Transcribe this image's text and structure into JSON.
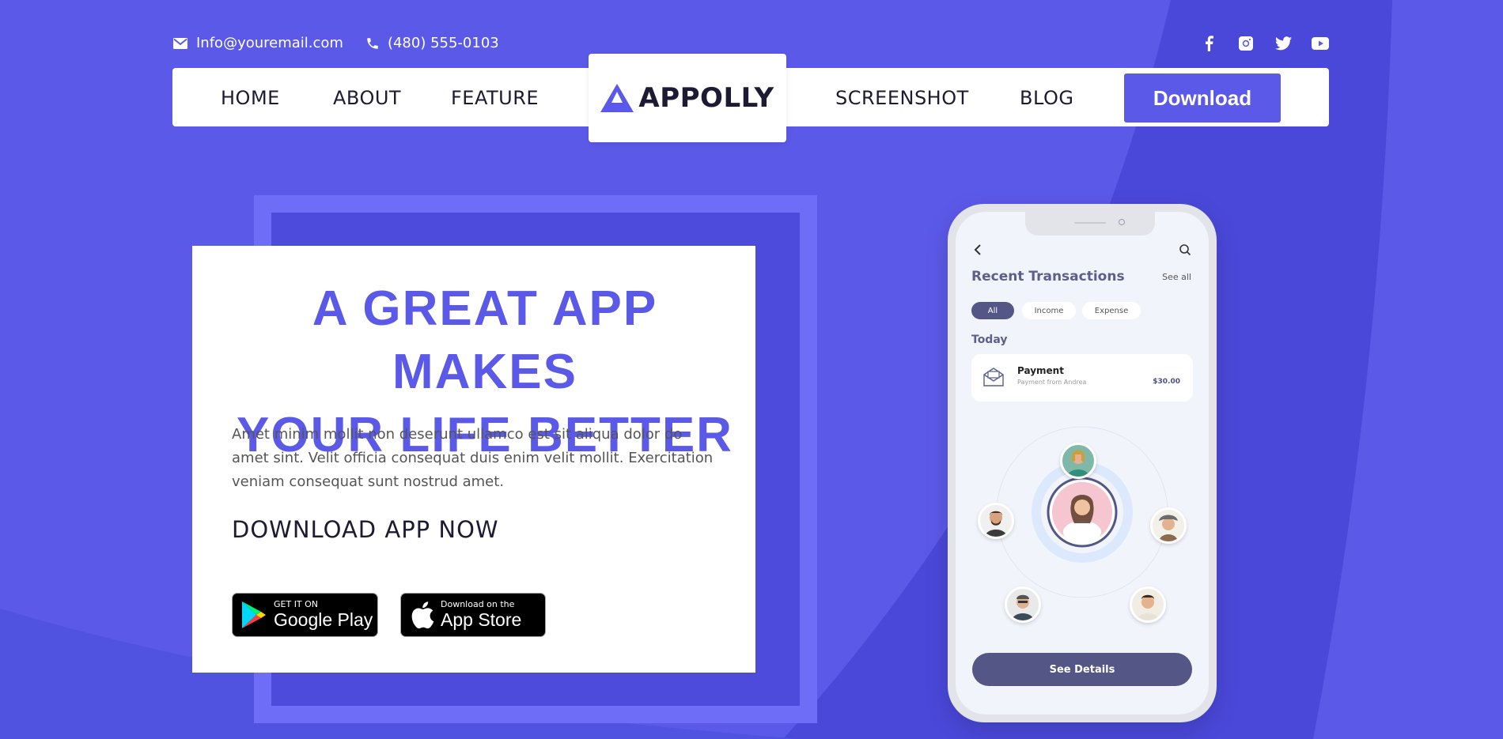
{
  "topbar": {
    "email": "Info@youremail.com",
    "phone": "(480) 555-0103",
    "social": [
      "facebook-icon",
      "instagram-icon",
      "twitter-icon",
      "youtube-icon"
    ]
  },
  "nav": {
    "items": [
      "HOME",
      "ABOUT",
      "FEATURE",
      "SCREENSHOT",
      "BLOG"
    ],
    "logo": "APPOLLY",
    "download_label": "Download"
  },
  "hero": {
    "title_line1": "A GREAT APP MAKES",
    "title_line2": "YOUR LIFE BETTER",
    "text": "Amet minim mollit non deserunt ullamco est sit aliqua dolor do amet sint. Velit officia consequat duis enim velit mollit. Exercitation veniam consequat sunt nostrud amet.",
    "cta": "DOWNLOAD APP NOW",
    "google_small": "GET IT ON",
    "google_big": "Google Play",
    "apple_small": "Download on the",
    "apple_big": "App Store"
  },
  "phone": {
    "title": "Recent Transactions",
    "see_all": "See all",
    "chips": [
      "All",
      "Income",
      "Expense"
    ],
    "today": "Today",
    "payment_name": "Payment",
    "payment_sub": "Payment from Andrea",
    "payment_amount": "$30.00",
    "details_button": "See Details"
  },
  "colors": {
    "brand": "#5b59e8",
    "dark": "#1d1b33",
    "phone_accent": "#545785"
  }
}
